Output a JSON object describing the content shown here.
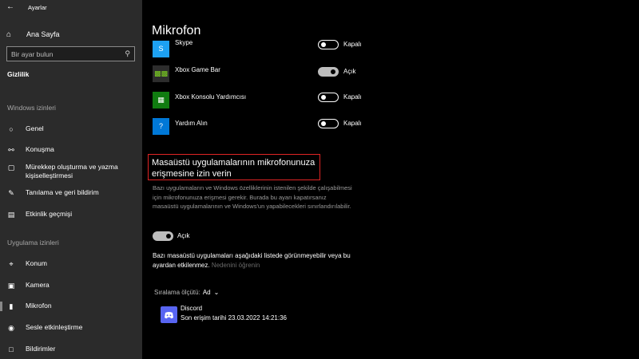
{
  "window": {
    "title": "Ayarlar",
    "back_icon": "back-arrow-icon"
  },
  "sidebar": {
    "home": {
      "label": "Ana Sayfa",
      "icon": "home-icon"
    },
    "search": {
      "placeholder": "Bir ayar bulun",
      "icon": "search-icon"
    },
    "section": "Gizlilik",
    "windows_permissions_label": "Windows izinleri",
    "windows_items": [
      {
        "label": "Genel",
        "icon": "lock-icon"
      },
      {
        "label": "Konuşma",
        "icon": "speech-icon"
      },
      {
        "label": "Mürekkep oluşturma ve yazma kişiselleştirmesi",
        "line1": "Mürekkep oluşturma ve yazma",
        "line2": "kişiselleştirmesi",
        "icon": "ink-icon"
      },
      {
        "label": "Tanılama ve geri bildirim",
        "icon": "feedback-icon"
      },
      {
        "label": "Etkinlik geçmişi",
        "icon": "timeline-icon"
      }
    ],
    "app_permissions_label": "Uygulama izinleri",
    "app_items": [
      {
        "label": "Konum",
        "icon": "location-icon"
      },
      {
        "label": "Kamera",
        "icon": "camera-icon"
      },
      {
        "label": "Mikrofon",
        "icon": "microphone-icon",
        "active": true
      },
      {
        "label": "Sesle etkinleştirme",
        "icon": "voice-activation-icon"
      },
      {
        "label": "Bildirimler",
        "icon": "notification-icon"
      }
    ]
  },
  "main": {
    "title": "Mikrofon",
    "apps": [
      {
        "name": "Skype",
        "state": "Kapalı",
        "on": false,
        "color": "#1da1f2"
      },
      {
        "name": "Xbox Game Bar",
        "state": "Açık",
        "on": true,
        "color": "#2d2d2d"
      },
      {
        "name": "Xbox Konsolu Yardımcısı",
        "state": "Kapalı",
        "on": false,
        "color": "#107c10"
      },
      {
        "name": "Yardım Alın",
        "state": "Kapalı",
        "on": false,
        "color": "#0078d7"
      }
    ],
    "desktop_section": {
      "heading": "Masaüstü uygulamalarının mikrofonunuza erişmesine izin verin",
      "description": "Bazı uygulamaların ve Windows özelliklerinin istenilen şekilde çalışabilmesi için mikrofonunuza erişmesi gerekir. Burada bu ayarı kapatırsanız masaüstü uygulamalarının ve Windows'un yapabilecekleri sınırlandırılabilir.",
      "toggle_state": "Açık",
      "note": "Bazı masaüstü uygulamaları aşağıdaki listede görünmeyebilir veya bu ayardan etkilenmez.",
      "note_link": "Nedenini öğrenin",
      "sort_label": "Sıralama ölçütü:",
      "sort_value": "Ad",
      "highlight_color": "#e02424"
    },
    "desktop_apps": [
      {
        "name": "Discord",
        "last_access": "Son erişim tarihi 23.03.2022 14:21:36",
        "color": "#5865f2"
      }
    ]
  }
}
